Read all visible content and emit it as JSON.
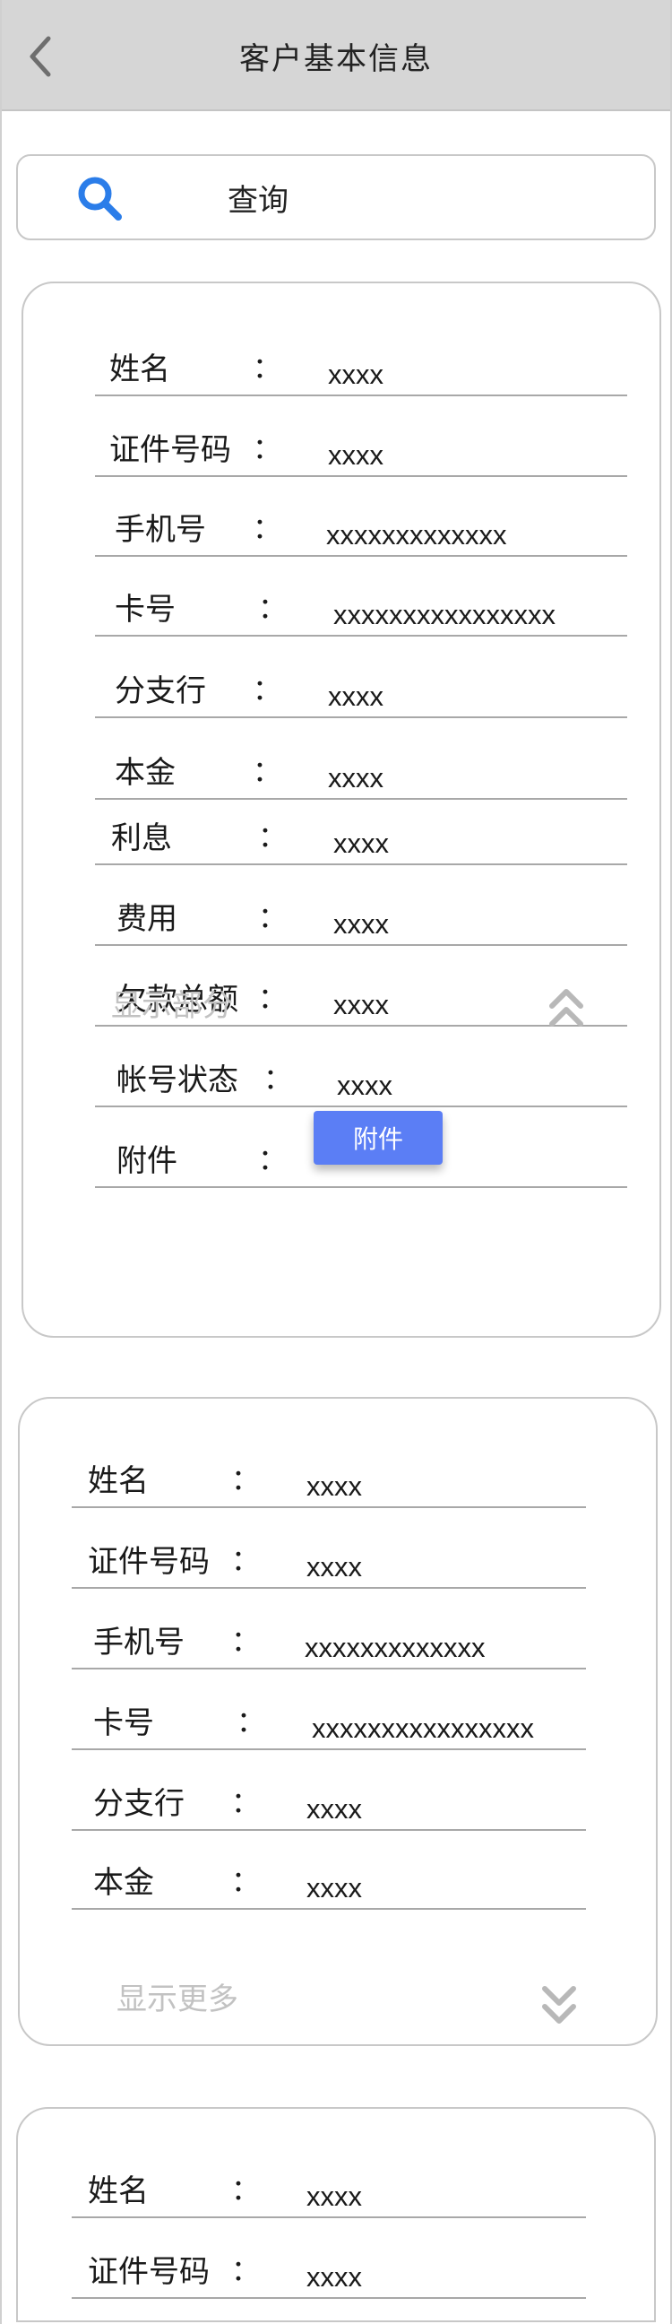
{
  "header": {
    "title": "客户基本信息",
    "back_icon": "chevron-left-icon"
  },
  "search": {
    "label": "查询",
    "icon": "search-icon",
    "icon_color": "#2b7de9"
  },
  "cards": [
    {
      "fields": [
        {
          "label": "姓名",
          "colon": "：",
          "value": "xxxx"
        },
        {
          "label": "证件号码",
          "colon": "：",
          "value": "xxxx"
        },
        {
          "label": "手机号",
          "colon": "：",
          "value": "xxxxxxxxxxxxx"
        },
        {
          "label": "卡号",
          "colon": "：",
          "value": "xxxxxxxxxxxxxxxx"
        },
        {
          "label": "分支行",
          "colon": "：",
          "value": "xxxx"
        },
        {
          "label": "本金",
          "colon": "：",
          "value": "xxxx"
        },
        {
          "label": "利息",
          "colon": "：",
          "value": "xxxx"
        },
        {
          "label": "费用",
          "colon": "：",
          "value": "xxxx"
        },
        {
          "label": "欠款总额",
          "colon": "：",
          "value": "xxxx"
        },
        {
          "label": "帐号状态",
          "colon": "：",
          "value": "xxxx"
        },
        {
          "label": "附件",
          "colon": "：",
          "button_label": "附件"
        }
      ],
      "toggle_label": "显示部分",
      "toggle_icon": "double-chevron-up-icon"
    },
    {
      "fields": [
        {
          "label": "姓名",
          "colon": "：",
          "value": "xxxx"
        },
        {
          "label": "证件号码",
          "colon": "：",
          "value": "xxxx"
        },
        {
          "label": "手机号",
          "colon": "：",
          "value": "xxxxxxxxxxxxx"
        },
        {
          "label": "卡号",
          "colon": "：",
          "value": "xxxxxxxxxxxxxxxx"
        },
        {
          "label": "分支行",
          "colon": "：",
          "value": "xxxx"
        },
        {
          "label": "本金",
          "colon": "：",
          "value": "xxxx"
        }
      ],
      "toggle_label": "显示更多",
      "toggle_icon": "double-chevron-down-icon"
    },
    {
      "fields": [
        {
          "label": "姓名",
          "colon": "：",
          "value": "xxxx"
        },
        {
          "label": "证件号码",
          "colon": "：",
          "value": "xxxx"
        }
      ]
    }
  ],
  "colors": {
    "accent": "#5b7ef5",
    "header_bg": "#d6d6d6",
    "muted_text": "#c2c2c2",
    "divider": "#a8a8a8"
  }
}
